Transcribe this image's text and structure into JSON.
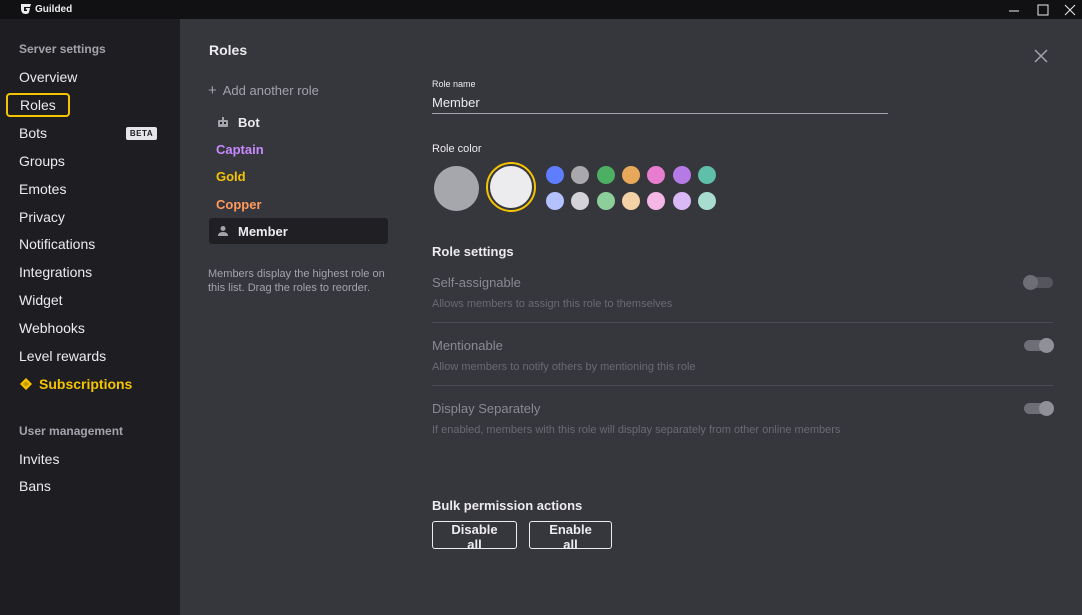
{
  "titlebar": {
    "app_name": "Guilded"
  },
  "sidebar": {
    "header_server": "Server settings",
    "items": [
      {
        "label": "Overview"
      },
      {
        "label": "Roles"
      },
      {
        "label": "Bots",
        "badge": "BETA"
      },
      {
        "label": "Groups"
      },
      {
        "label": "Emotes"
      },
      {
        "label": "Privacy"
      },
      {
        "label": "Notifications"
      },
      {
        "label": "Integrations"
      },
      {
        "label": "Widget"
      },
      {
        "label": "Webhooks"
      },
      {
        "label": "Level rewards"
      },
      {
        "label": "Subscriptions"
      }
    ],
    "header_user": "User management",
    "user_items": [
      {
        "label": "Invites"
      },
      {
        "label": "Bans"
      }
    ]
  },
  "main": {
    "title": "Roles",
    "add_role_label": "Add another role",
    "roles": [
      {
        "name": "Bot",
        "color": "#ececee",
        "icon": "bot-icon"
      },
      {
        "name": "Captain",
        "color": "#c88aff"
      },
      {
        "name": "Gold",
        "color": "#f5c400"
      },
      {
        "name": "Copper",
        "color": "#ff9a5c"
      },
      {
        "name": "Member",
        "color": "#ececee",
        "icon": "user-icon"
      }
    ],
    "roles_note": "Members display the highest role on this list. Drag the roles to reorder."
  },
  "editor": {
    "role_name_label": "Role name",
    "role_name_value": "Member",
    "role_color_label": "Role color",
    "palette_row1": [
      "#5f7dff",
      "#a9a9ad",
      "#4caf63",
      "#e8a85a",
      "#e87dd0",
      "#b57ae6",
      "#5fbfa8"
    ],
    "palette_row2": [
      "#b4c2ff",
      "#d4d4d8",
      "#8ccf9a",
      "#f5d2a6",
      "#f5b8e6",
      "#d9b8f5",
      "#a8dccf"
    ],
    "role_settings_title": "Role settings",
    "settings": [
      {
        "title": "Self-assignable",
        "desc": "Allows members to assign this role to themselves",
        "enabled": false
      },
      {
        "title": "Mentionable",
        "desc": "Allow members to notify others by mentioning this role",
        "enabled": true
      },
      {
        "title": "Display Separately",
        "desc": "If enabled, members with this role will display separately from other online members",
        "enabled": true
      }
    ],
    "bulk_title": "Bulk permission actions",
    "disable_all": "Disable all",
    "enable_all": "Enable all"
  },
  "colors": {
    "accent": "#f5c400"
  }
}
